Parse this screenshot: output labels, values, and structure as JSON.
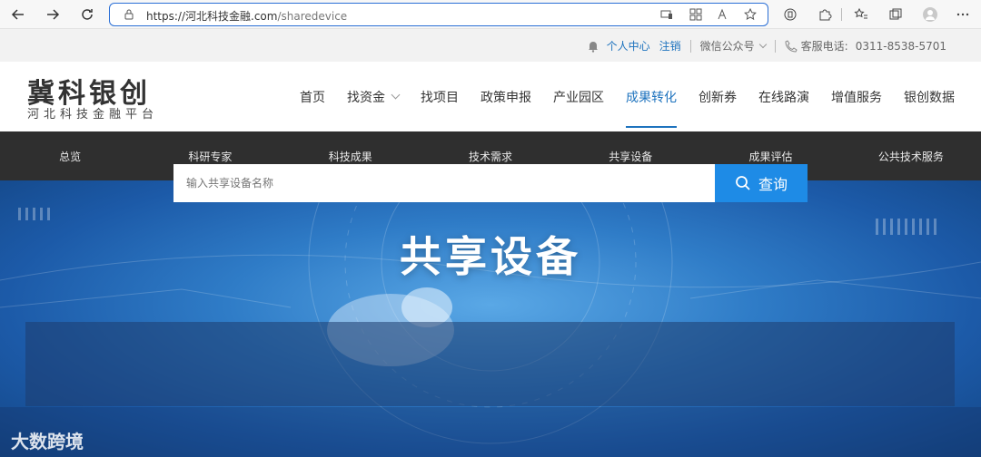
{
  "browser": {
    "url_host": "https://河北科技金融.com",
    "url_path": "/sharedevice"
  },
  "top_bar": {
    "personal_center": "个人中心",
    "logout": "注销",
    "wechat": "微信公众号",
    "hotline_label": "客服电话:",
    "hotline_number": "0311-8538-5701"
  },
  "logo": {
    "main": "冀科银创",
    "sub": "河北科技金融平台"
  },
  "main_nav": [
    {
      "label": "首页"
    },
    {
      "label": "找资金"
    },
    {
      "label": "找项目"
    },
    {
      "label": "政策申报"
    },
    {
      "label": "产业园区"
    },
    {
      "label": "成果转化"
    },
    {
      "label": "创新券"
    },
    {
      "label": "在线路演"
    },
    {
      "label": "增值服务"
    },
    {
      "label": "银创数据"
    }
  ],
  "sub_nav": [
    {
      "label": "总览"
    },
    {
      "label": "科研专家"
    },
    {
      "label": "科技成果"
    },
    {
      "label": "技术需求"
    },
    {
      "label": "共享设备"
    },
    {
      "label": "成果评估"
    },
    {
      "label": "公共技术服务"
    }
  ],
  "banner": {
    "title": "共享设备",
    "search_placeholder": "输入共享设备名称",
    "search_button": "查询",
    "watermark": "大数跨境"
  },
  "colors": {
    "accent": "#1e73be",
    "subnav_bg": "#2f2f2f",
    "search_button": "#1e8be6"
  }
}
